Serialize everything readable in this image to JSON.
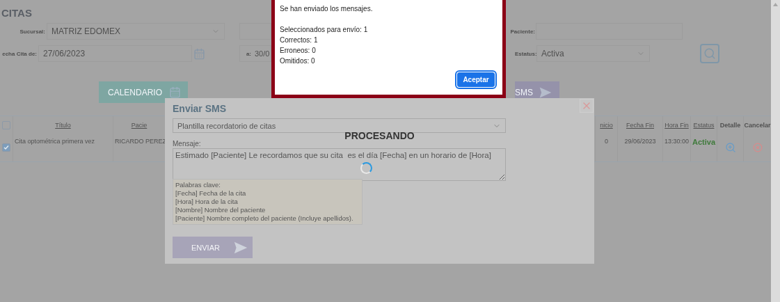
{
  "page": {
    "title": "CITAS",
    "branch": {
      "label": "Sucursal:",
      "value": "MATRIZ EDOMEX"
    },
    "date_from": {
      "label": "echa Cita de:",
      "value": "27/06/2023"
    },
    "date_to": {
      "label": "a:",
      "value": "30/0"
    },
    "patient": {
      "label": "Paciente:"
    },
    "status": {
      "label": "Estatus:",
      "value": "Activa"
    },
    "buttons": [
      {
        "kind": "calendar",
        "label": "CALENDARIO"
      },
      {
        "kind": "sms",
        "label": "SMS"
      }
    ]
  },
  "table": {
    "select_all": {
      "checked": false
    },
    "columns": [
      "Título",
      "Pacie",
      "nicio",
      "Fecha Fin",
      "Hora Fin",
      "Estatus",
      "Detalle",
      "Cancelar"
    ],
    "rows": [
      {
        "checked": true,
        "cells": [
          "Cita optométrica primera vez",
          "RICARDO PEREZ",
          "0",
          "29/06/2023",
          "13:30:00",
          "Activa"
        ]
      }
    ]
  },
  "sms_modal": {
    "title": "Enviar SMS",
    "template": "Plantilla recordatorio de citas",
    "message_label": "Mensaje:",
    "message": "Estimado [Paciente] Le recordamos que su cita  es el día [Fecha] en un horario de [Hora]",
    "keywords": [
      "Palabras clave:",
      "[Fecha] Fecha de la cita",
      "[Hora] Hora de la cita",
      "[Nombre] Nombre del paciente",
      "[Paciente] Nombre completo del paciente (Incluye apellidos)."
    ],
    "send_button": "ENVIAR",
    "processing": "PROCESANDO"
  },
  "alert": {
    "heading": "Se han enviado los mensajes.",
    "lines": [
      "Seleccionados para envío: 1",
      "Correctos: 1",
      "Erroneos: 0",
      "Omitidos: 0"
    ],
    "button": "Aceptar"
  }
}
